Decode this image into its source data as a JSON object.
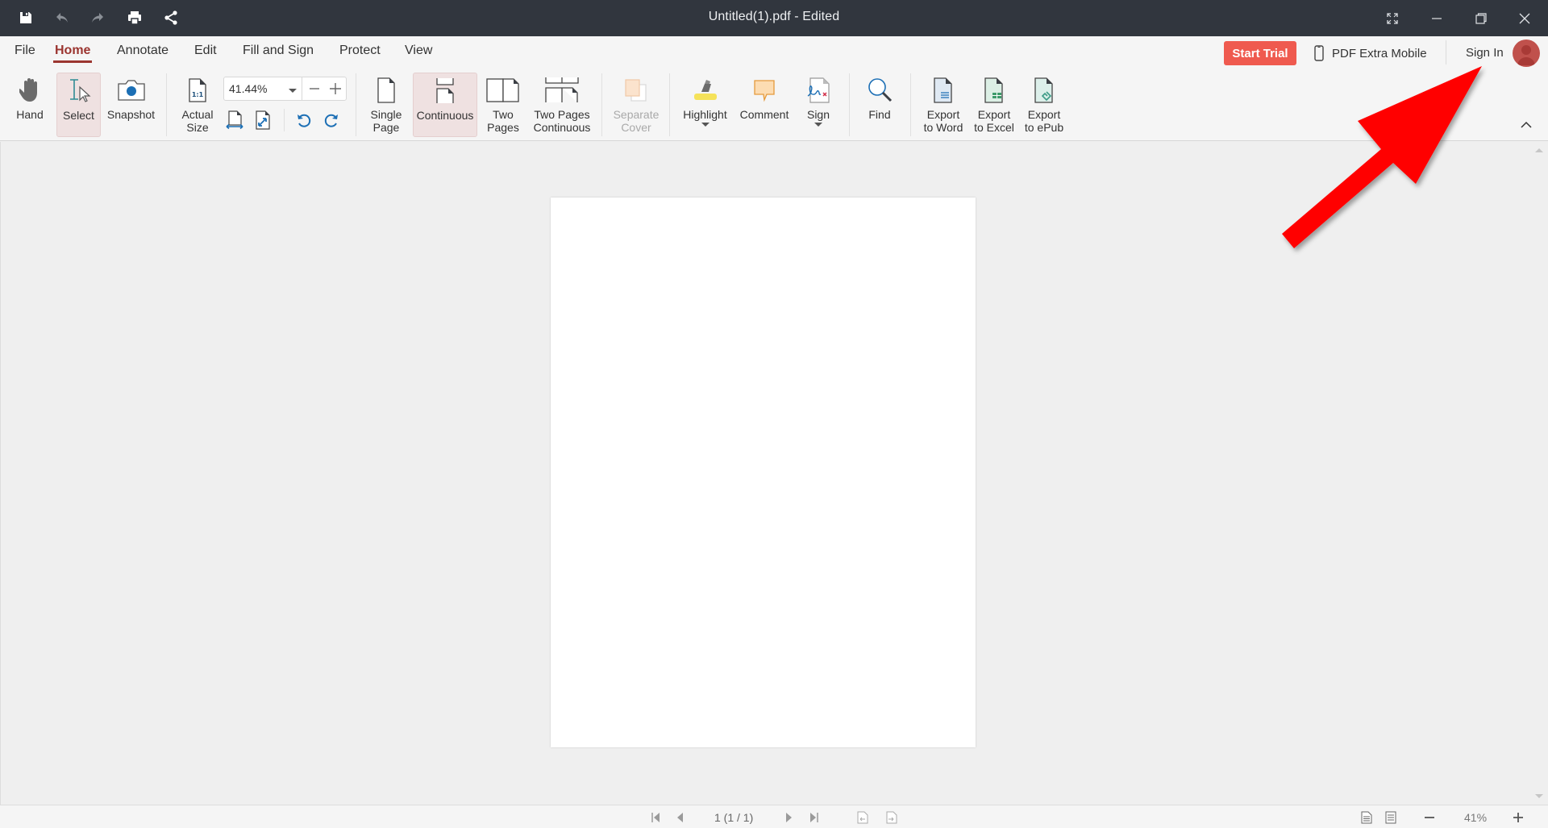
{
  "titlebar": {
    "title": "Untitled(1).pdf - Edited",
    "quick_actions": [
      "save-icon",
      "undo-icon",
      "redo-icon",
      "print-icon",
      "share-icon"
    ],
    "window_controls": [
      "fullscreen-icon",
      "minimize-icon",
      "restore-icon",
      "close-icon"
    ]
  },
  "menu": {
    "tabs": [
      {
        "label": "File",
        "active": false
      },
      {
        "label": "Home",
        "active": true
      },
      {
        "label": "Annotate",
        "active": false
      },
      {
        "label": "Edit",
        "active": false
      },
      {
        "label": "Fill and Sign",
        "active": false
      },
      {
        "label": "Protect",
        "active": false
      },
      {
        "label": "View",
        "active": false
      }
    ],
    "start_trial": "Start Trial",
    "mobile_link": "PDF Extra Mobile",
    "sign_in": "Sign In"
  },
  "ribbon": {
    "hand": "Hand",
    "select": "Select",
    "snapshot": "Snapshot",
    "actual_size": "Actual\nSize",
    "zoom_value": "41.44%",
    "single_page": "Single\nPage",
    "continuous": "Continuous",
    "two_pages": "Two\nPages",
    "two_pages_continuous": "Two Pages\nContinuous",
    "separate_cover": "Separate\nCover",
    "highlight": "Highlight",
    "comment": "Comment",
    "sign": "Sign",
    "find": "Find",
    "export_word": "Export\nto Word",
    "export_excel": "Export\nto Excel",
    "export_epub": "Export\nto ePub",
    "active_tool": "Select",
    "active_layout": "Continuous",
    "colors": {
      "accent": "#9b3530",
      "trial": "#ef5a4f",
      "icon_blue": "#1c6fb5"
    }
  },
  "statusbar": {
    "page_indicator": "1 (1 / 1)",
    "zoom_percent": "41%"
  }
}
